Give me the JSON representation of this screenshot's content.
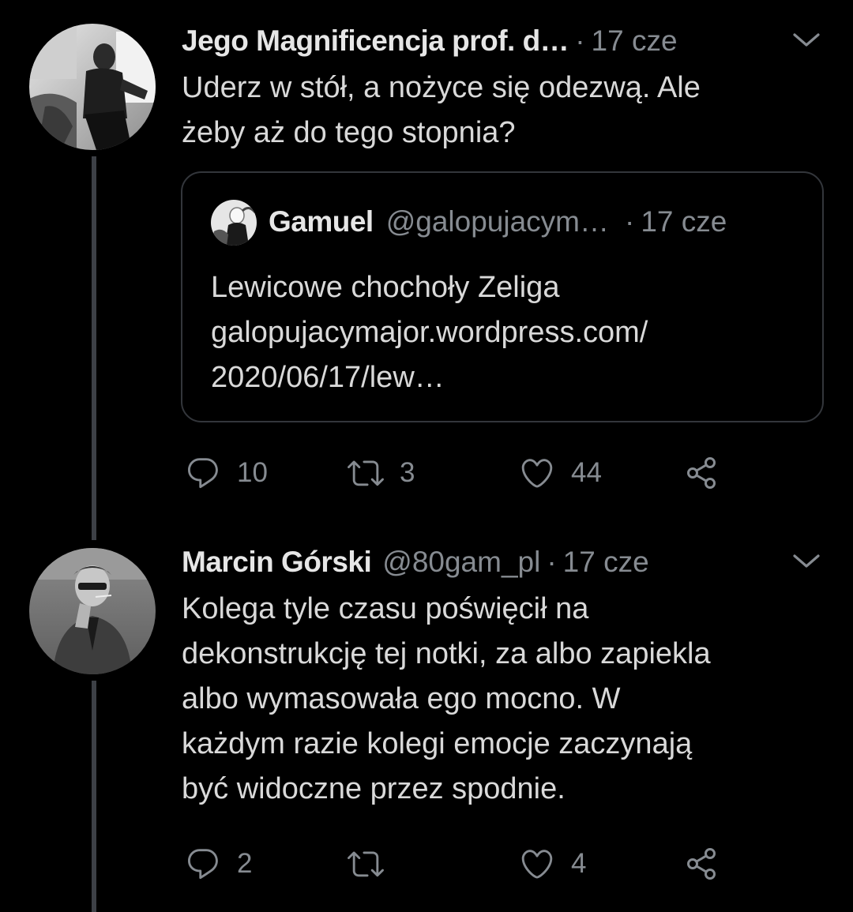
{
  "tweets": [
    {
      "author_name": "Jego Magnificencja prof. d…",
      "handle": "",
      "separator": "·",
      "time": "17 cze",
      "text_lines": [
        "Uderz w stół, a nożyce się odezwą. Ale",
        "żeby aż do tego stopnia?"
      ],
      "quote": {
        "author_name": "Gamuel",
        "handle": "@galopujacym…",
        "separator": "·",
        "time": "17 cze",
        "text_lines": [
          "Lewicowe chochoły Zeliga",
          "galopujacymajor.wordpress.com/",
          "2020/06/17/lew…"
        ]
      },
      "actions": {
        "replies": "10",
        "retweets": "3",
        "likes": "44"
      }
    },
    {
      "author_name": "Marcin Górski",
      "handle": "@80gam_pl",
      "separator": "·",
      "time": "17 cze",
      "text_lines": [
        "Kolega tyle czasu poświęcił na",
        "dekonstrukcję tej notki, za albo zapiekla",
        "albo wymasowała ego mocno. W",
        "każdym razie kolegi emocje zaczynają",
        "być widoczne przez spodnie."
      ],
      "actions": {
        "replies": "2",
        "retweets": "",
        "likes": "4"
      }
    }
  ],
  "icons": {
    "reply": "speech-bubble-icon",
    "retweet": "retweet-arrows-icon",
    "like": "heart-outline-icon",
    "share": "share-nodes-icon",
    "menu": "chevron-down-icon"
  },
  "colors": {
    "background": "#000000",
    "text": "#d9d9d9",
    "muted": "#868b91",
    "thread_line": "#3d4046",
    "card_border": "#33363b"
  }
}
